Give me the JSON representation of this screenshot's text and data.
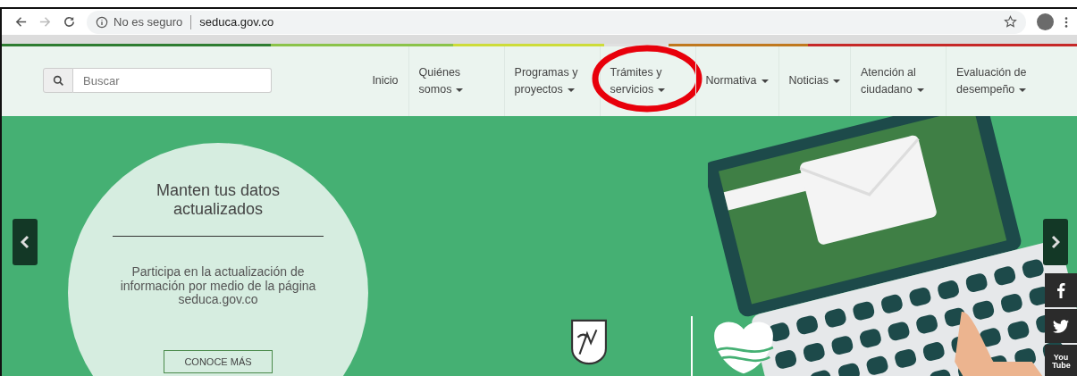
{
  "browser": {
    "security": "No es seguro",
    "url": "seduca.gov.co"
  },
  "search": {
    "placeholder": "Buscar"
  },
  "nav": [
    {
      "label": "Inicio",
      "dropdown": false,
      "highlighted": false
    },
    {
      "label": "Quiénes somos",
      "dropdown": true,
      "highlighted": false
    },
    {
      "label": "Programas y proyectos",
      "dropdown": true,
      "highlighted": false
    },
    {
      "label": "Trámites y servicios",
      "dropdown": true,
      "highlighted": true
    },
    {
      "label": "Normativa",
      "dropdown": true,
      "highlighted": false
    },
    {
      "label": "Noticias",
      "dropdown": true,
      "highlighted": false
    },
    {
      "label": "Atención al ciudadano",
      "dropdown": true,
      "highlighted": false
    },
    {
      "label": "Evaluación de desempeño",
      "dropdown": true,
      "highlighted": false
    }
  ],
  "slide": {
    "title": "Manten tus datos actualizados",
    "text": "Participa en la actualización de información por medio de la página seduca.gov.co",
    "button": "CONOCE MÁS"
  },
  "social": [
    {
      "kind": "facebook"
    },
    {
      "kind": "twitter"
    },
    {
      "kind": "youtube",
      "label": "You Tube"
    }
  ]
}
